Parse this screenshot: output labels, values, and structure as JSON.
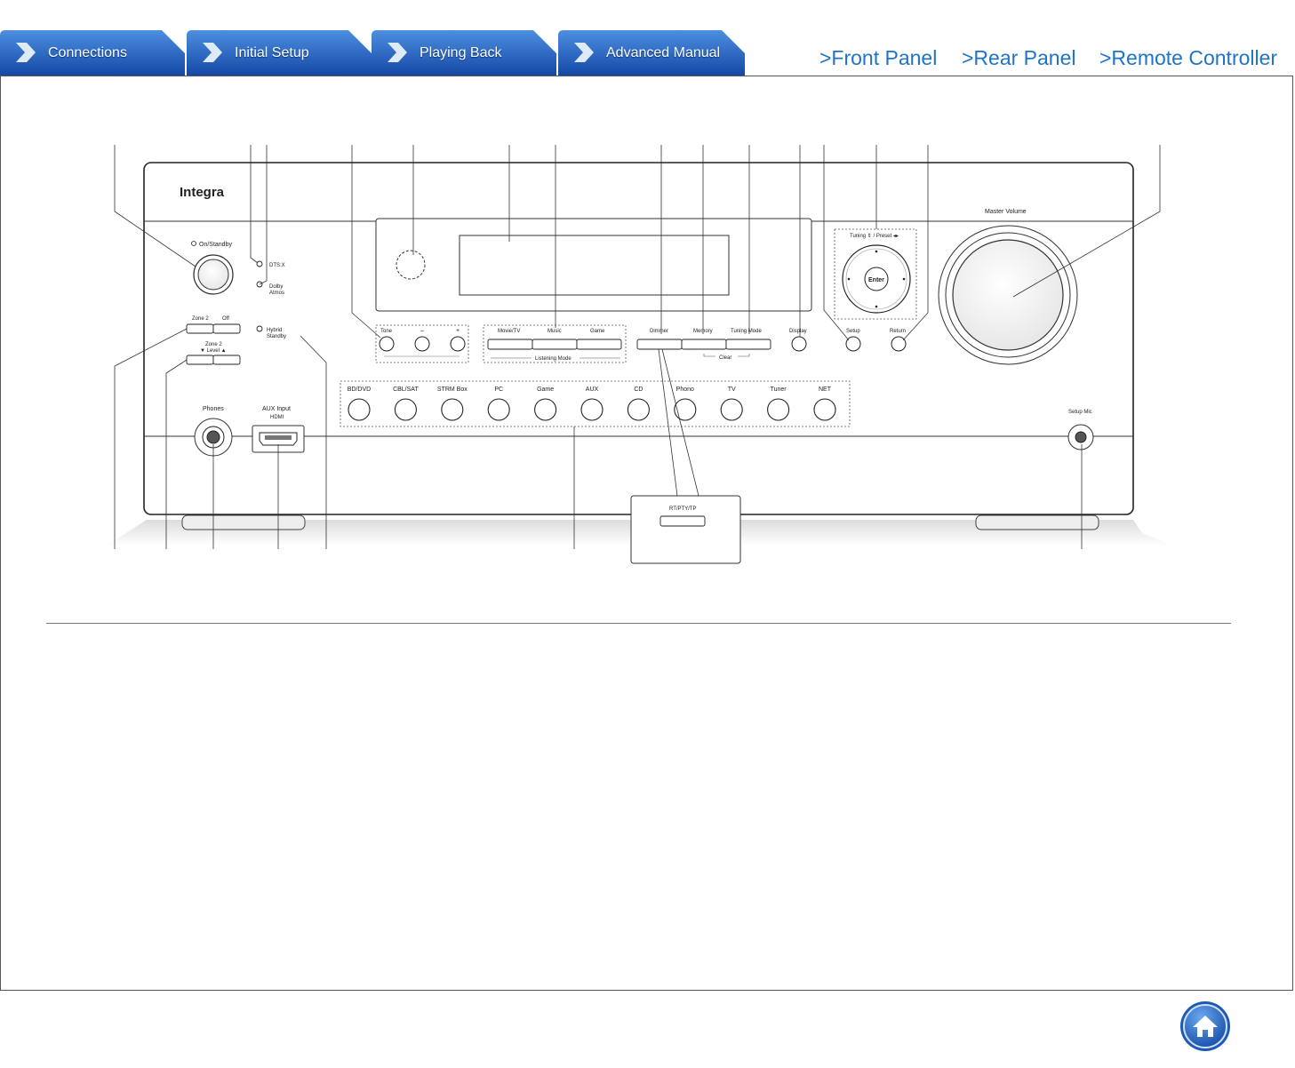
{
  "tabs": [
    {
      "label": "Connections"
    },
    {
      "label": "Initial Setup"
    },
    {
      "label": "Playing Back"
    },
    {
      "label": "Advanced Manual"
    }
  ],
  "links": {
    "front_panel": ">Front Panel",
    "rear_panel": ">Rear Panel",
    "remote_controller": ">Remote Controller"
  },
  "device": {
    "brand": "Integra",
    "power_label": "On/Standby",
    "dtsx_label": "DTS:X",
    "dolby_label_1": "Dolby",
    "dolby_label_2": "Atmos",
    "hybrid_label_1": "Hybrid",
    "hybrid_label_2": "Standby",
    "zone2_label": "Zone 2",
    "off_label": "Off",
    "zone2_level_1": "Zone 2",
    "zone2_level_2": "▼  Level  ▲",
    "tone_label": "Tone",
    "minus_label": "–",
    "plus_label": "+",
    "listening": {
      "movie_tv": "Movie/TV",
      "music": "Music",
      "game": "Game",
      "group_label": "Listening Mode"
    },
    "dimmer_label": "Dimmer",
    "memory_label": "Memory",
    "tuning_mode_label": "Tuning Mode",
    "clear_label": "Clear",
    "display_label": "Display",
    "setup_label": "Setup",
    "return_label": "Return",
    "tuning_preset_label": "Tuning ⇕ / Preset ◂▸",
    "enter_label": "Enter",
    "master_volume_label": "Master Volume",
    "inputs": [
      {
        "label": "BD/DVD"
      },
      {
        "label": "CBL/SAT"
      },
      {
        "label": "STRM Box"
      },
      {
        "label": "PC"
      },
      {
        "label": "Game"
      },
      {
        "label": "AUX"
      },
      {
        "label": "CD"
      },
      {
        "label": "Phono"
      },
      {
        "label": "TV"
      },
      {
        "label": "Tuner"
      },
      {
        "label": "NET"
      }
    ],
    "phones_label": "Phones",
    "aux_input_label": "AUX Input",
    "hdmi_label": "HDMI",
    "setup_mic_label": "Setup Mic",
    "rt_pty_tp_label": "RT/PTY/TP"
  }
}
